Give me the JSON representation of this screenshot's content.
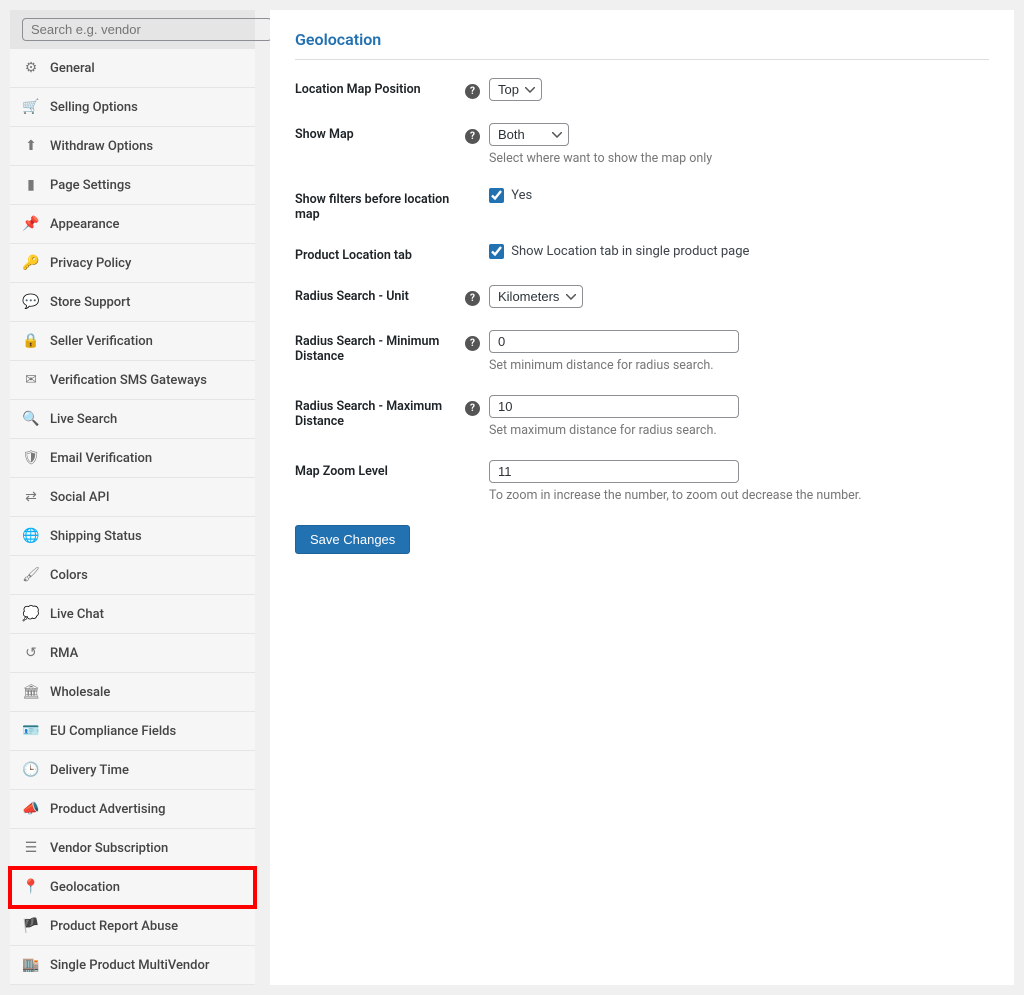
{
  "sidebar": {
    "search_placeholder": "Search e.g. vendor",
    "items": [
      {
        "label": "General"
      },
      {
        "label": "Selling Options"
      },
      {
        "label": "Withdraw Options"
      },
      {
        "label": "Page Settings"
      },
      {
        "label": "Appearance"
      },
      {
        "label": "Privacy Policy"
      },
      {
        "label": "Store Support"
      },
      {
        "label": "Seller Verification"
      },
      {
        "label": "Verification SMS Gateways"
      },
      {
        "label": "Live Search"
      },
      {
        "label": "Email Verification"
      },
      {
        "label": "Social API"
      },
      {
        "label": "Shipping Status"
      },
      {
        "label": "Colors"
      },
      {
        "label": "Live Chat"
      },
      {
        "label": "RMA"
      },
      {
        "label": "Wholesale"
      },
      {
        "label": "EU Compliance Fields"
      },
      {
        "label": "Delivery Time"
      },
      {
        "label": "Product Advertising"
      },
      {
        "label": "Vendor Subscription"
      },
      {
        "label": "Geolocation"
      },
      {
        "label": "Product Report Abuse"
      },
      {
        "label": "Single Product MultiVendor"
      }
    ]
  },
  "main": {
    "title": "Geolocation",
    "location_map_position": {
      "label": "Location Map Position",
      "value": "Top"
    },
    "show_map": {
      "label": "Show Map",
      "value": "Both",
      "hint": "Select where want to show the map only"
    },
    "filters_before_map": {
      "label": "Show filters before location map",
      "checkbox_label": "Yes",
      "checked": true
    },
    "product_location_tab": {
      "label": "Product Location tab",
      "checkbox_label": "Show Location tab in single product page",
      "checked": true
    },
    "radius_unit": {
      "label": "Radius Search - Unit",
      "value": "Kilometers"
    },
    "radius_min": {
      "label": "Radius Search - Minimum Distance",
      "value": "0",
      "hint": "Set minimum distance for radius search."
    },
    "radius_max": {
      "label": "Radius Search - Maximum Distance",
      "value": "10",
      "hint": "Set maximum distance for radius search."
    },
    "zoom": {
      "label": "Map Zoom Level",
      "value": "11",
      "hint": "To zoom in increase the number, to zoom out decrease the number."
    },
    "save_button": "Save Changes"
  }
}
